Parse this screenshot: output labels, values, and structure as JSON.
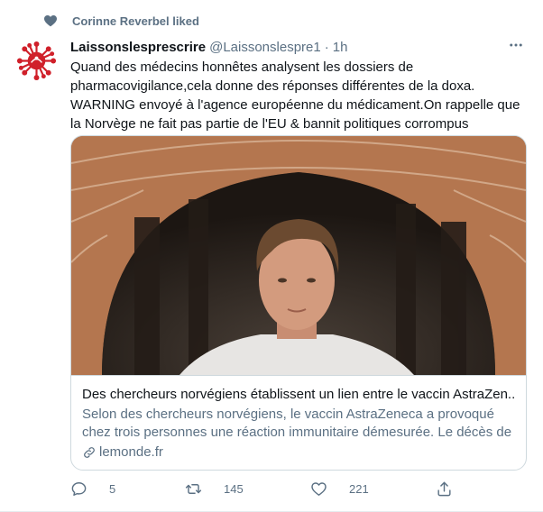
{
  "social_context": {
    "text": "Corinne Reverbel liked"
  },
  "tweet": {
    "display_name": "Laissonslesprescrire",
    "handle": "@Laissonslespre1",
    "separator": "·",
    "time": "1h",
    "text_lines": [
      "Quand des médecins honnêtes analysent les dossiers de",
      "pharmacovigilance,cela donne des réponses différentes de la doxa.",
      "WARNING envoyé à l'agence européenne du médicament.On rappelle que",
      "la Norvège ne fait pas partie de l'EU & bannit politiques corrompus"
    ]
  },
  "card": {
    "title": "Des chercheurs norvégiens établissent un lien entre le vaccin AstraZen...",
    "description": "Selon des chercheurs norvégiens, le vaccin AstraZeneca a provoqué chez trois personnes une réaction immunitaire démesurée. Le décès de l'un...",
    "domain": "lemonde.fr"
  },
  "actions": {
    "replies": "5",
    "retweets": "145",
    "likes": "221"
  },
  "colors": {
    "secondary_text": "#5b7083",
    "primary_text": "#0f1419",
    "border": "#cfd9de",
    "avatar_red": "#d0202a"
  },
  "icons": [
    "heart-icon",
    "more-icon",
    "link-icon",
    "reply-icon",
    "retweet-icon",
    "like-icon",
    "share-icon"
  ]
}
